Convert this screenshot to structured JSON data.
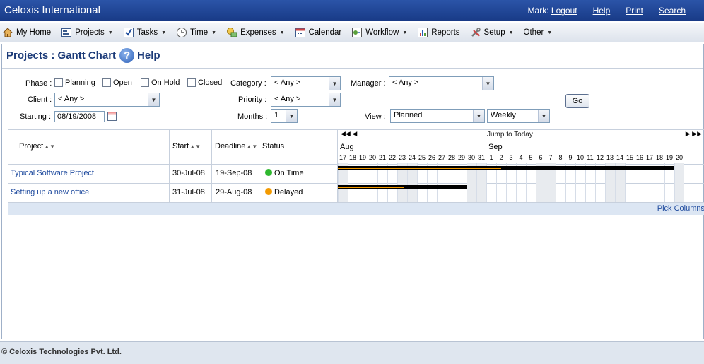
{
  "app": {
    "title": "Celoxis International"
  },
  "topnav": {
    "user": "Mark:",
    "logout": "Logout",
    "help": "Help",
    "print": "Print",
    "search": "Search"
  },
  "menu": [
    {
      "label": "My Home",
      "icon": "home-icon",
      "dropdown": false
    },
    {
      "label": "Projects",
      "icon": "projects-icon",
      "dropdown": true
    },
    {
      "label": "Tasks",
      "icon": "checkmark-icon",
      "dropdown": true
    },
    {
      "label": "Time",
      "icon": "clock-icon",
      "dropdown": true
    },
    {
      "label": "Expenses",
      "icon": "expenses-icon",
      "dropdown": true
    },
    {
      "label": "Calendar",
      "icon": "calendar-icon",
      "dropdown": false
    },
    {
      "label": "Workflow",
      "icon": "workflow-icon",
      "dropdown": true
    },
    {
      "label": "Reports",
      "icon": "reports-icon",
      "dropdown": false
    },
    {
      "label": "Setup",
      "icon": "tools-icon",
      "dropdown": true
    },
    {
      "label": "Other",
      "icon": "",
      "dropdown": true
    }
  ],
  "page": {
    "title": "Projects : Gantt Chart",
    "help": "Help"
  },
  "filters": {
    "phase_label": "Phase :",
    "phases": [
      "Planning",
      "Open",
      "On Hold",
      "Closed"
    ],
    "client_label": "Client :",
    "client_value": "< Any >",
    "starting_label": "Starting :",
    "starting_value": "08/19/2008",
    "category_label": "Category :",
    "category_value": "< Any >",
    "priority_label": "Priority :",
    "priority_value": "< Any >",
    "months_label": "Months :",
    "months_value": "1",
    "manager_label": "Manager :",
    "manager_value": "< Any >",
    "view_label": "View :",
    "view_value": "Planned",
    "scale_value": "Weekly",
    "go_label": "Go"
  },
  "table": {
    "columns": [
      "Project",
      "Start",
      "Deadline",
      "Status"
    ],
    "rows": [
      {
        "project": "Typical Software Project",
        "start": "30-Jul-08",
        "deadline": "19-Sep-08",
        "status": "On Time",
        "status_color": "#2eb82e"
      },
      {
        "project": "Setting up a new office",
        "start": "31-Jul-08",
        "deadline": "29-Aug-08",
        "status": "Delayed",
        "status_color": "#f39a00"
      }
    ],
    "pick_columns": "Pick Columns"
  },
  "gantt": {
    "jump_to_today": "Jump to Today",
    "nav_prev": "◀◀ ◀",
    "nav_next": "▶ ▶▶",
    "months": [
      "Aug",
      "Sep"
    ],
    "days": [
      "17",
      "18",
      "19",
      "20",
      "21",
      "22",
      "23",
      "24",
      "25",
      "26",
      "27",
      "28",
      "29",
      "30",
      "31",
      "1",
      "2",
      "3",
      "4",
      "5",
      "6",
      "7",
      "8",
      "9",
      "10",
      "11",
      "12",
      "13",
      "14",
      "15",
      "16",
      "17",
      "18",
      "19",
      "20"
    ],
    "weekend_indices": [
      0,
      6,
      7,
      13,
      14,
      20,
      21,
      27,
      28,
      34
    ],
    "today_index": 2,
    "bars": [
      {
        "black_start": 0,
        "black_end": 34,
        "orange_start": 0,
        "orange_end": 16.5
      },
      {
        "black_start": 0,
        "black_end": 13,
        "orange_start": 0,
        "orange_end": 6.7
      }
    ]
  },
  "footer": {
    "copyright": "© Celoxis Technologies Pvt. Ltd."
  },
  "colors": {
    "titlebar": "#1b3f8b",
    "link": "#1e4a9e",
    "on_time": "#2eb82e",
    "delayed": "#f39a00",
    "today": "#dd0000"
  }
}
